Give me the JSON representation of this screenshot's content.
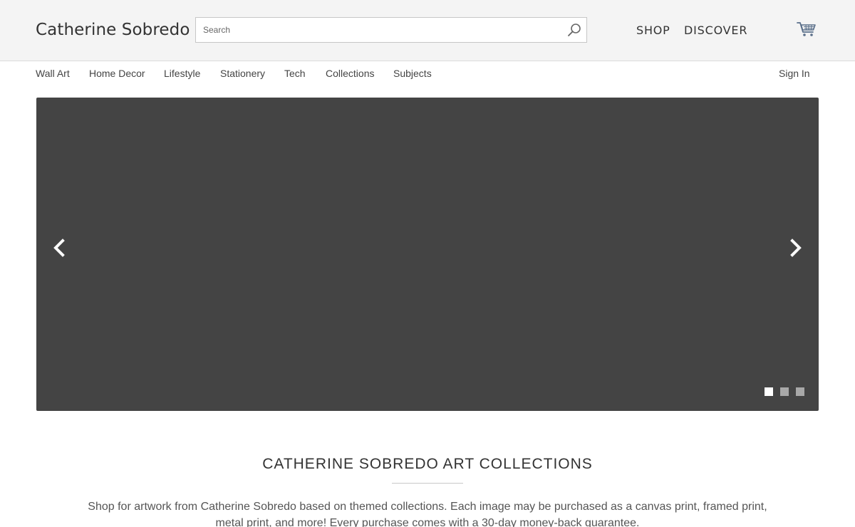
{
  "header": {
    "brand": "Catherine Sobredo",
    "search_placeholder": "Search",
    "nav": [
      "SHOP",
      "DISCOVER"
    ]
  },
  "subnav": {
    "items": [
      "Wall Art",
      "Home Decor",
      "Lifestyle",
      "Stationery",
      "Tech",
      "Collections",
      "Subjects"
    ],
    "sign_in": "Sign In"
  },
  "hero": {
    "slide_count": 3,
    "active_slide": 1
  },
  "collections": {
    "title": "CATHERINE SOBREDO ART COLLECTIONS",
    "description": "Shop for artwork from Catherine Sobredo based on themed collections. Each image may be purchased as a canvas print, framed print, metal print, and more! Every purchase comes with a 30-day money-back guarantee."
  },
  "colors": {
    "topbar_bg": "#f4f4f4",
    "hero_bg": "#444444",
    "dot_active": "#ffffff",
    "dot_inactive": "#a8a8a8"
  }
}
